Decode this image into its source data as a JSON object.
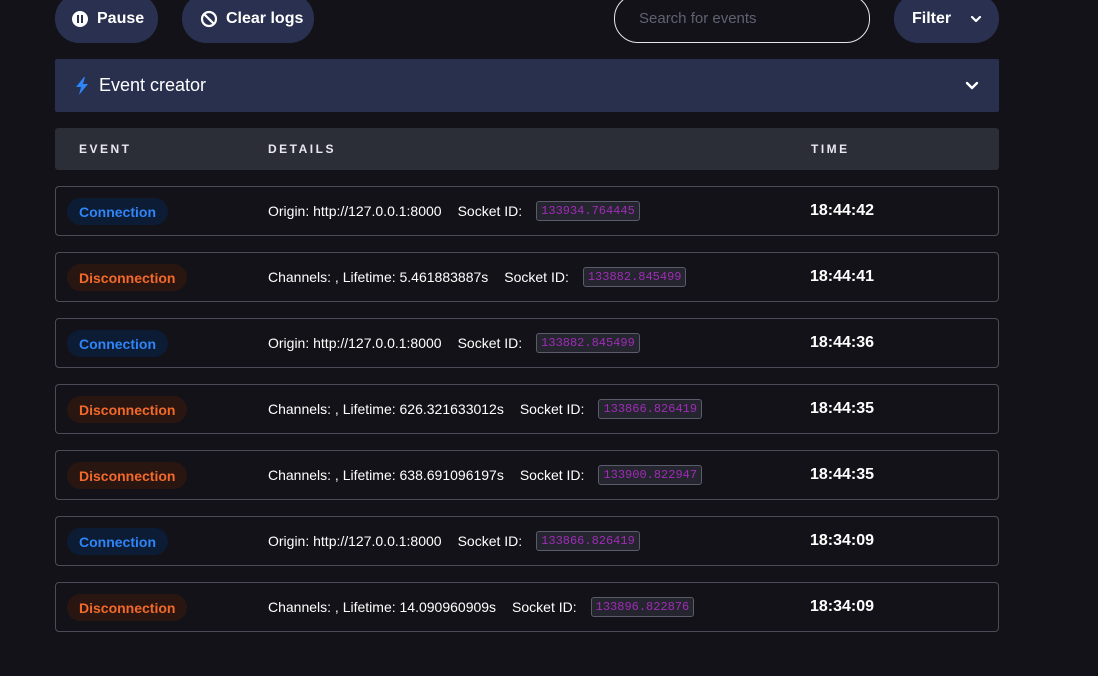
{
  "toolbar": {
    "pause_label": "Pause",
    "clear_label": "Clear logs",
    "search_placeholder": "Search for events",
    "filter_label": "Filter"
  },
  "event_creator": {
    "title": "Event creator"
  },
  "table": {
    "headers": {
      "event": "EVENT",
      "details": "DETAILS",
      "time": "TIME"
    },
    "rows": [
      {
        "type": "Connection",
        "kind": "connection",
        "detail_a": "Origin: http://127.0.0.1:8000",
        "socket_label": "Socket ID:",
        "socket_id": "133934.764445",
        "time": "18:44:42"
      },
      {
        "type": "Disconnection",
        "kind": "disconnection",
        "detail_a": "Channels: , Lifetime: 5.461883887s",
        "socket_label": "Socket ID:",
        "socket_id": "133882.845499",
        "time": "18:44:41"
      },
      {
        "type": "Connection",
        "kind": "connection",
        "detail_a": "Origin: http://127.0.0.1:8000",
        "socket_label": "Socket ID:",
        "socket_id": "133882.845499",
        "time": "18:44:36"
      },
      {
        "type": "Disconnection",
        "kind": "disconnection",
        "detail_a": "Channels: , Lifetime: 626.321633012s",
        "socket_label": "Socket ID:",
        "socket_id": "133866.826419",
        "time": "18:44:35"
      },
      {
        "type": "Disconnection",
        "kind": "disconnection",
        "detail_a": "Channels: , Lifetime: 638.691096197s",
        "socket_label": "Socket ID:",
        "socket_id": "133900.822947",
        "time": "18:44:35"
      },
      {
        "type": "Connection",
        "kind": "connection",
        "detail_a": "Origin: http://127.0.0.1:8000",
        "socket_label": "Socket ID:",
        "socket_id": "133866.826419",
        "time": "18:34:09"
      },
      {
        "type": "Disconnection",
        "kind": "disconnection",
        "detail_a": "Channels: , Lifetime: 14.090960909s",
        "socket_label": "Socket ID:",
        "socket_id": "133896.822876",
        "time": "18:34:09"
      }
    ]
  },
  "icons": {
    "pause": "pause-circle-icon",
    "clear": "prohibited-icon",
    "filter": "chevron-down-icon",
    "creator": "lightning-bolt-icon",
    "expand": "chevron-down-icon"
  },
  "colors": {
    "background": "#121218",
    "button": "#2a3150",
    "connection_text": "#2f84f7",
    "disconnection_text": "#f2692a",
    "socket_id_text": "#a02cb6",
    "bolt": "#2f84f7"
  }
}
